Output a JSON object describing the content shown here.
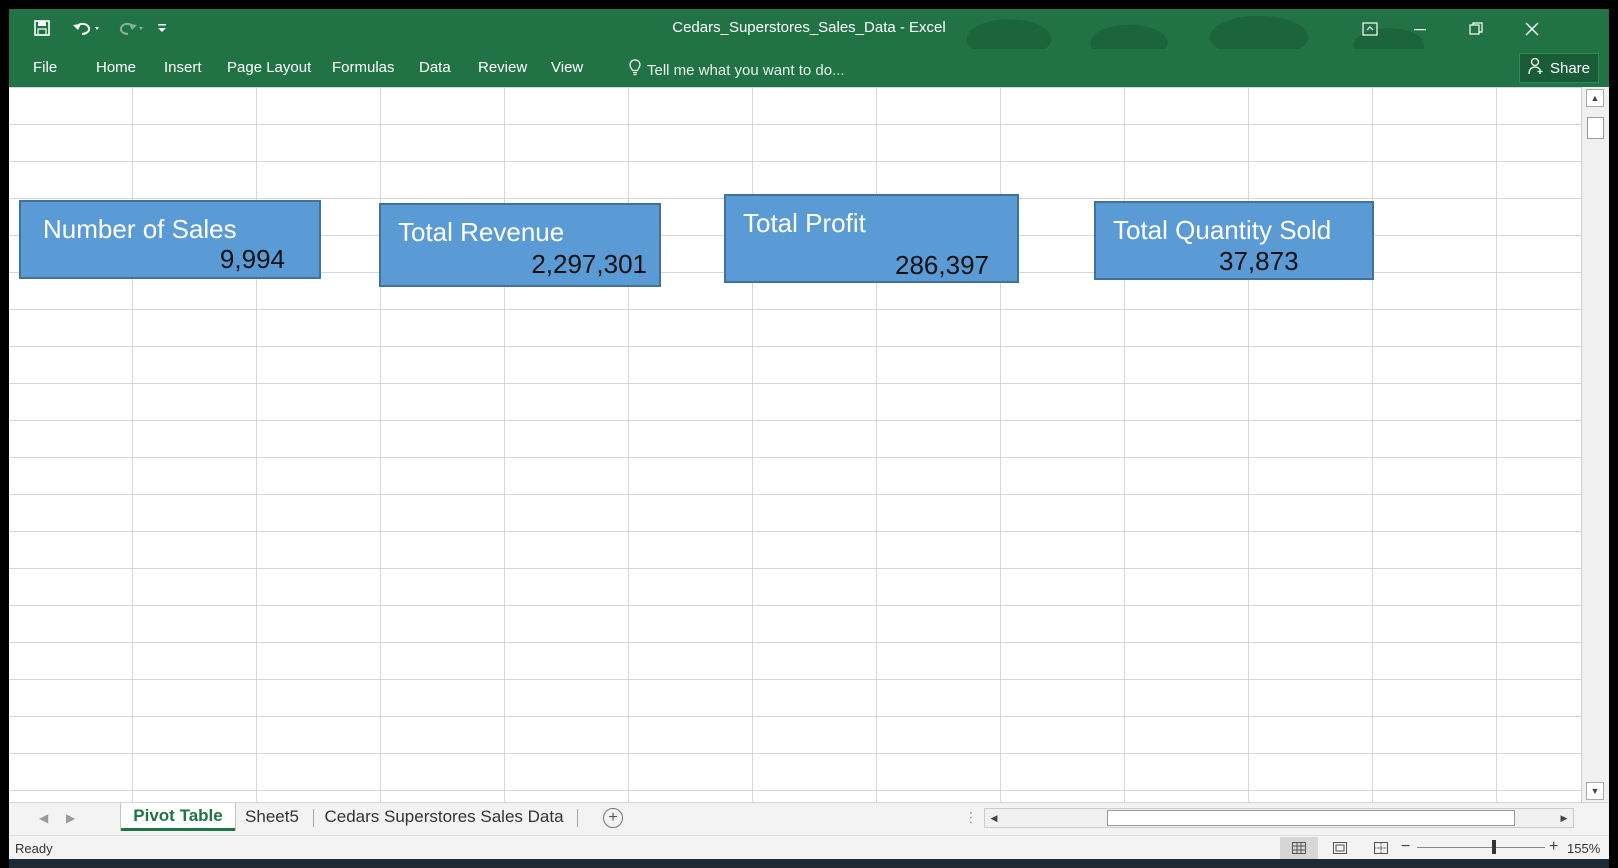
{
  "window": {
    "title": "Cedars_Superstores_Sales_Data - Excel",
    "accent_color": "#217346"
  },
  "quick_access": {
    "save_icon": "save-icon",
    "undo_icon": "undo-icon",
    "redo_icon": "redo-icon",
    "customize_icon": "customize-qat-icon"
  },
  "menu": {
    "items": [
      "File",
      "Home",
      "Insert",
      "Page Layout",
      "Formulas",
      "Data",
      "Review",
      "View"
    ],
    "tell_me_placeholder": "Tell me what you want to do...",
    "share_label": "Share"
  },
  "cards": [
    {
      "label": "Number of Sales",
      "value": "9,994"
    },
    {
      "label": "Total Revenue",
      "value": "2,297,301"
    },
    {
      "label": "Total Profit",
      "value": "286,397"
    },
    {
      "label": "Total Quantity Sold",
      "value": "37,873"
    }
  ],
  "card_colors": {
    "fill": "#5b9bd5",
    "border": "#41719c"
  },
  "sheets": {
    "tabs": [
      "Pivot Table",
      "Sheet5",
      "Cedars Superstores Sales Data"
    ],
    "active_index": 0
  },
  "status": {
    "text": "Ready",
    "zoom": "155%",
    "zoom_fraction": 0.6
  }
}
